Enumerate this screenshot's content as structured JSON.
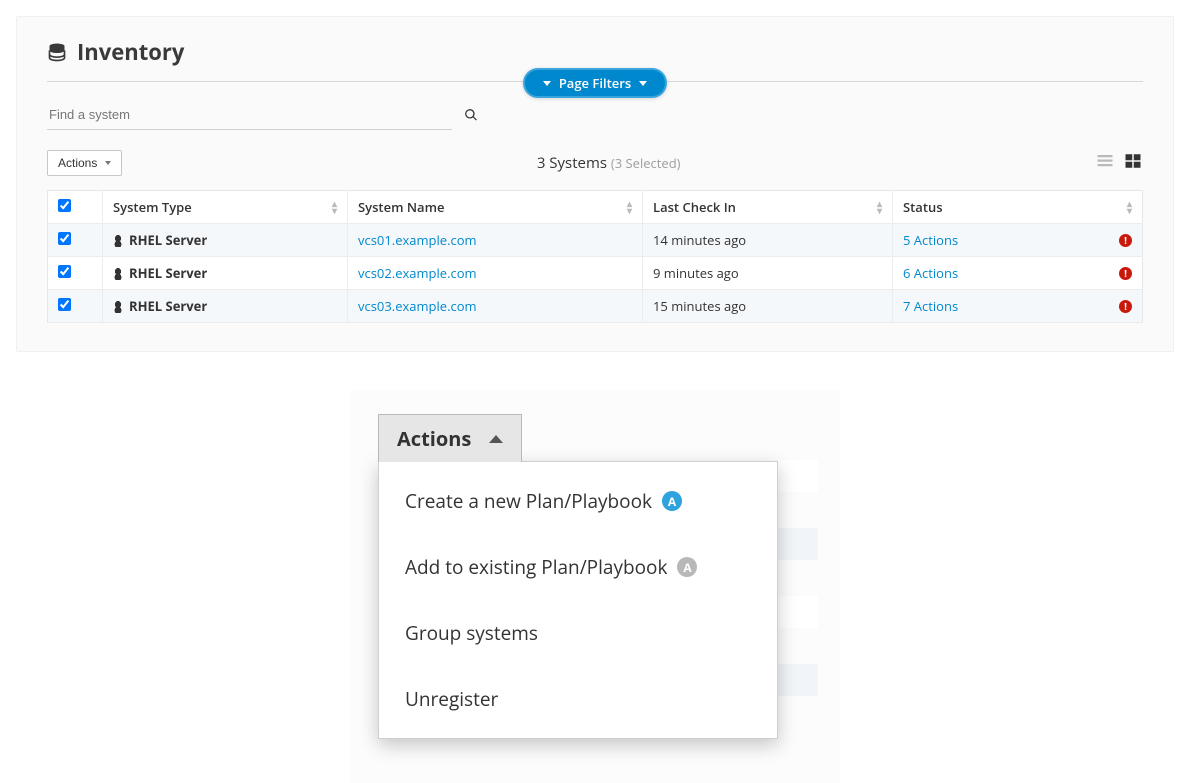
{
  "page": {
    "title": "Inventory",
    "filters_button": "Page Filters",
    "search_placeholder": "Find a system",
    "actions_button": "Actions",
    "count_prefix": "3 Systems",
    "count_suffix": "(3 Selected)"
  },
  "table": {
    "headers": {
      "type": "System Type",
      "name": "System Name",
      "last": "Last Check In",
      "status": "Status"
    },
    "rows": [
      {
        "type": "RHEL Server",
        "name": "vcs01.example.com",
        "last": "14 minutes ago",
        "status": "5 Actions"
      },
      {
        "type": "RHEL Server",
        "name": "vcs02.example.com",
        "last": "9 minutes ago",
        "status": "6 Actions"
      },
      {
        "type": "RHEL Server",
        "name": "vcs03.example.com",
        "last": "15 minutes ago",
        "status": "7 Actions"
      }
    ]
  },
  "zoom": {
    "button": "Actions",
    "items": {
      "create": "Create a new Plan/Playbook",
      "add": "Add to existing Plan/Playbook",
      "group": "Group systems",
      "unreg": "Unregister"
    }
  }
}
